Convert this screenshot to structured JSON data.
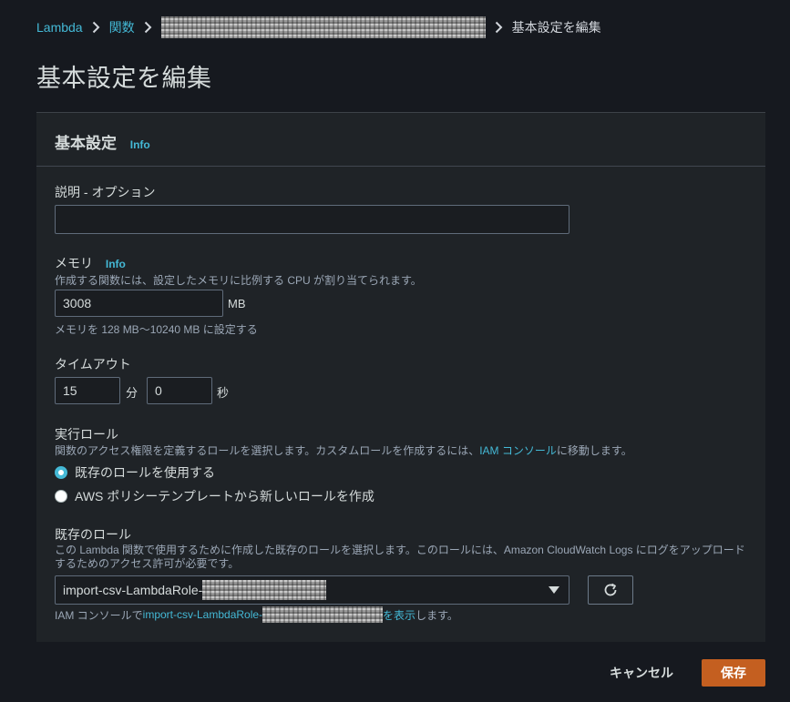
{
  "breadcrumb": {
    "root": "Lambda",
    "functions": "関数",
    "current": "基本設定を編集"
  },
  "page_title": "基本設定を編集",
  "card": {
    "title": "基本設定",
    "info": "Info"
  },
  "description": {
    "label": "説明 - オプション",
    "value": ""
  },
  "memory": {
    "label": "メモリ",
    "info": "Info",
    "help": "作成する関数には、設定したメモリに比例する CPU が割り当てられます。",
    "value": "3008",
    "unit": "MB",
    "constraint": "メモリを 128 MB〜10240 MB に設定する"
  },
  "timeout": {
    "label": "タイムアウト",
    "minutes": "15",
    "minutes_unit": "分",
    "seconds": "0",
    "seconds_unit": "秒"
  },
  "execution_role": {
    "label": "実行ロール",
    "help_prefix": "関数のアクセス権限を定義するロールを選択します。カスタムロールを作成するには、",
    "help_link": "IAM コンソール",
    "help_suffix": "に移動します。",
    "options": [
      {
        "label": "既存のロールを使用する",
        "selected": true
      },
      {
        "label": "AWS ポリシーテンプレートから新しいロールを作成",
        "selected": false
      }
    ]
  },
  "existing_role": {
    "label": "既存のロール",
    "help_line1": "この Lambda 関数で使用するために作成した既存のロールを選択します。このロールには、Amazon CloudWatch Logs にログをアップロード",
    "help_line2": "するためのアクセス許可が必要です。",
    "selected_prefix": "import-csv-LambdaRole-",
    "footer_prefix": "IAM コンソールで ",
    "footer_link_prefix": "import-csv-LambdaRole-",
    "footer_suffix_link": "を表示",
    "footer_suffix": "します。"
  },
  "actions": {
    "cancel": "キャンセル",
    "save": "保存"
  },
  "colors": {
    "background": "#16191f",
    "panel": "#1f2327",
    "link": "#44b9d6",
    "primary_button": "#c45f20"
  }
}
